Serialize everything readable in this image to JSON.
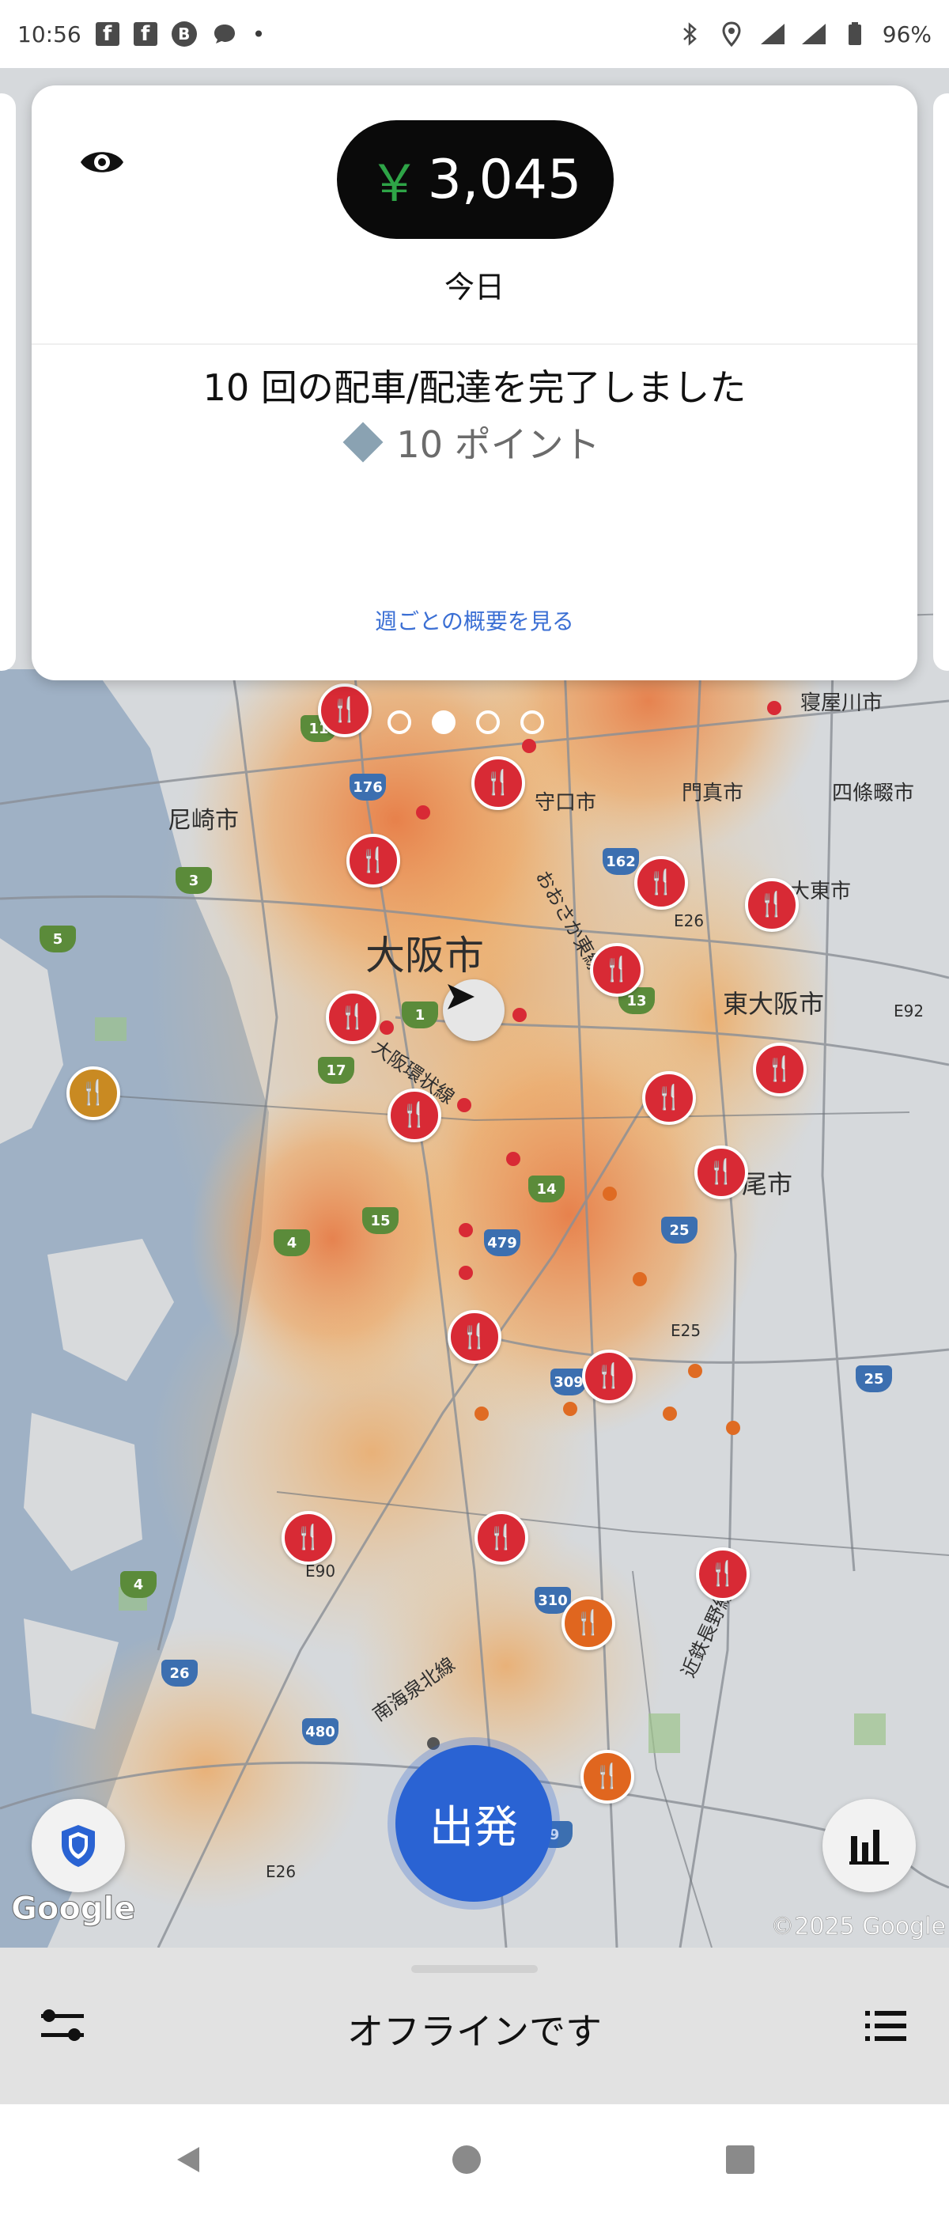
{
  "status_bar": {
    "time": "10:56",
    "notification_icons": [
      "facebook-icon",
      "facebook-icon",
      "b-app-icon",
      "chat-icon"
    ],
    "dot": "•",
    "battery": "96%"
  },
  "earnings_card": {
    "currency_symbol": "￥",
    "amount": "3,045",
    "period": "今日",
    "trips_text": "10 回の配車/配達を完了しました",
    "points_text": "10 ポイント",
    "weekly_link": "週ごとの概要を見る",
    "pager": {
      "count": 4,
      "active_index": 1
    }
  },
  "map": {
    "labels": {
      "osaka": "大阪市",
      "amagasaki": "尼崎市",
      "moriguchi": "守口市",
      "kadoma": "門真市",
      "shijonawate": "四條畷市",
      "daito": "大東市",
      "higashiosaka": "東大阪市",
      "yao": "尾市",
      "neyagawa": "寝屋川市",
      "osaka_loop": "大阪環状線",
      "osaka_higashi": "おおさか東線",
      "nankai": "南海泉北線",
      "kintetsu": "近鉄長野線",
      "e26": "E26",
      "e92": "E92",
      "e25": "E25",
      "e90": "E90",
      "e26b": "E26"
    },
    "route_shields": [
      "11",
      "176",
      "162",
      "3",
      "5",
      "1",
      "13",
      "17",
      "15",
      "14",
      "479",
      "4",
      "25",
      "309",
      "310",
      "26",
      "480",
      "4",
      "9",
      "25"
    ],
    "google_logo": "Google",
    "copyright": "©2025 Google"
  },
  "go_button": {
    "label": "出発"
  },
  "bottom_sheet": {
    "status": "オフラインです"
  },
  "colors": {
    "accent_blue": "#2a63d3",
    "earnings_green": "#2ea447",
    "pin_red": "#d82a35",
    "pin_orange": "#e0661f"
  }
}
